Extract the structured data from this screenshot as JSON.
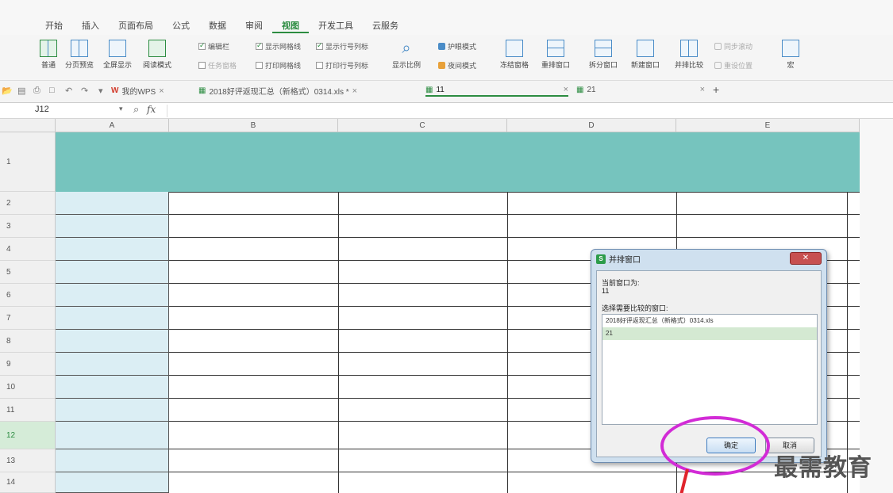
{
  "menu": {
    "tabs": [
      "开始",
      "插入",
      "页面布局",
      "公式",
      "数据",
      "审阅",
      "视图",
      "开发工具",
      "云服务"
    ],
    "active_index": 6
  },
  "ribbon": {
    "normal": "普通",
    "page_break": "分页预览",
    "full_screen": "全屏显示",
    "reading_mode": "阅读模式",
    "edit_bar": "编辑栏",
    "task_pane": "任务窗格",
    "show_gridlines": "显示网格线",
    "print_gridlines": "打印网格线",
    "show_headings": "显示行号列标",
    "print_headings": "打印行号列标",
    "zoom": "显示比例",
    "eye_protection": "护眼模式",
    "night_mode": "夜间模式",
    "freeze": "冻结窗格",
    "rearrange": "重排窗口",
    "split": "拆分窗口",
    "new_window": "新建窗口",
    "side_by_side": "并排比较",
    "sync_scroll": "同步滚动",
    "reset_position": "重设位置",
    "macro": "宏"
  },
  "docbar": {
    "tabs": [
      {
        "label": "我的WPS"
      },
      {
        "label": "2018好评返现汇总（新格式）0314.xls *"
      },
      {
        "label": "11"
      },
      {
        "label": "21"
      }
    ],
    "add": "+"
  },
  "formula_bar": {
    "cell_ref": "J12",
    "fx": "fx"
  },
  "grid": {
    "columns": [
      "A",
      "B",
      "C",
      "D",
      "E"
    ],
    "rows": [
      "1",
      "2",
      "3",
      "4",
      "5",
      "6",
      "7",
      "8",
      "9",
      "10",
      "11",
      "12",
      "13",
      "14"
    ],
    "selected_row": "12"
  },
  "dialog": {
    "title": "并排窗口",
    "current_label": "当前窗口为:",
    "current_value": "11",
    "choose_label": "选择需要比较的窗口:",
    "options": [
      "2018好评返现汇总（新格式）0314.xls",
      "21"
    ],
    "selected_option": "21",
    "ok": "确定",
    "cancel": "取消",
    "close": "✕"
  },
  "watermark": "最需教育",
  "colors": {
    "header_teal": "#76c4be",
    "column_a_fill": "#dbeef4",
    "accent_green": "#2c8c41",
    "annotation_magenta": "#d22bd6",
    "annotation_arrow": "#e0242c"
  }
}
